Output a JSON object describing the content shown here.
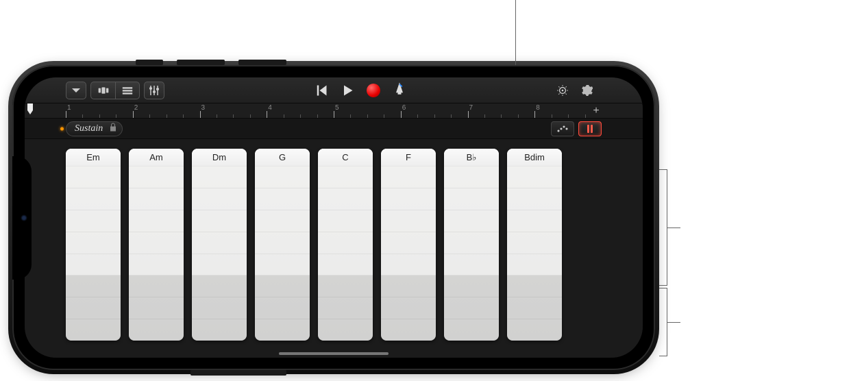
{
  "toolbar": {
    "my_songs_icon": "chevron-down",
    "browser_icon": "view-browser",
    "tracks_icon": "view-tracks",
    "fx_icon": "mixer-sliders",
    "prev_icon": "previous",
    "play_icon": "play",
    "record_icon": "record",
    "metronome_icon": "metronome",
    "nav_icon": "navigation-knob",
    "settings_icon": "settings-gear"
  },
  "ruler": {
    "bars": [
      "1",
      "2",
      "3",
      "4",
      "5",
      "6",
      "7",
      "8"
    ],
    "plus_label": "+"
  },
  "control_row": {
    "sustain_label": "Sustain",
    "lock_icon": "lock",
    "arpeggiator_icon": "autoplay-arp",
    "chord_strips_icon": "chord-strips"
  },
  "chords": [
    {
      "label": "Em"
    },
    {
      "label": "Am"
    },
    {
      "label": "Dm"
    },
    {
      "label": "G"
    },
    {
      "label": "C"
    },
    {
      "label": "F"
    },
    {
      "label": "B♭"
    },
    {
      "label": "Bdim"
    }
  ],
  "colors": {
    "record": "#e60000",
    "metronome": "#2e8cff",
    "active_button": "#ff4a3d",
    "playhead_dot": "#ff9500"
  }
}
